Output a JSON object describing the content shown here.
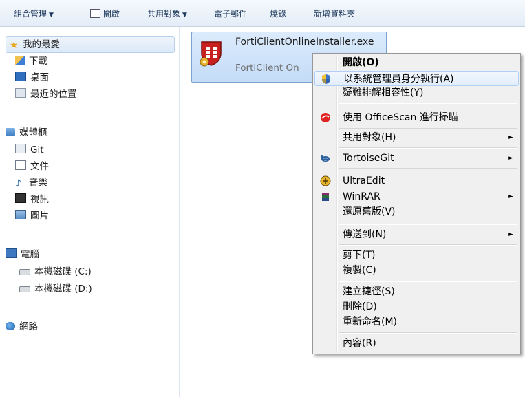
{
  "toolbar": {
    "organize": "組合管理",
    "open": "開啟",
    "share": "共用對象",
    "email": "電子郵件",
    "burn": "燒錄",
    "new_folder": "新增資料夾"
  },
  "nav": {
    "favorites": "我的最愛",
    "downloads": "下載",
    "desktop": "桌面",
    "recent": "最近的位置",
    "libraries": "媒體櫃",
    "git": "Git",
    "documents": "文件",
    "music": "音樂",
    "videos": "視訊",
    "pictures": "圖片",
    "computer": "電腦",
    "drive_c": "本機磁碟 (C:)",
    "drive_d": "本機磁碟 (D:)",
    "network": "網路"
  },
  "file": {
    "name": "FortiClientOnlineInstaller.exe",
    "type": "FortiClient On"
  },
  "menu": {
    "open": "開啟(O)",
    "run_as_admin": "以系統管理員身分執行(A)",
    "troubleshoot": "疑難排解相容性(Y)",
    "officescan": "使用 OfficeScan 進行掃瞄",
    "share_with": "共用對象(H)",
    "tortoisegit": "TortoiseGit",
    "ultraedit": "UltraEdit",
    "winrar": "WinRAR",
    "restore": "還原舊版(V)",
    "send_to": "傳送到(N)",
    "cut": "剪下(T)",
    "copy": "複製(C)",
    "create_shortcut": "建立捷徑(S)",
    "delete": "刪除(D)",
    "rename": "重新命名(M)",
    "properties": "內容(R)"
  }
}
